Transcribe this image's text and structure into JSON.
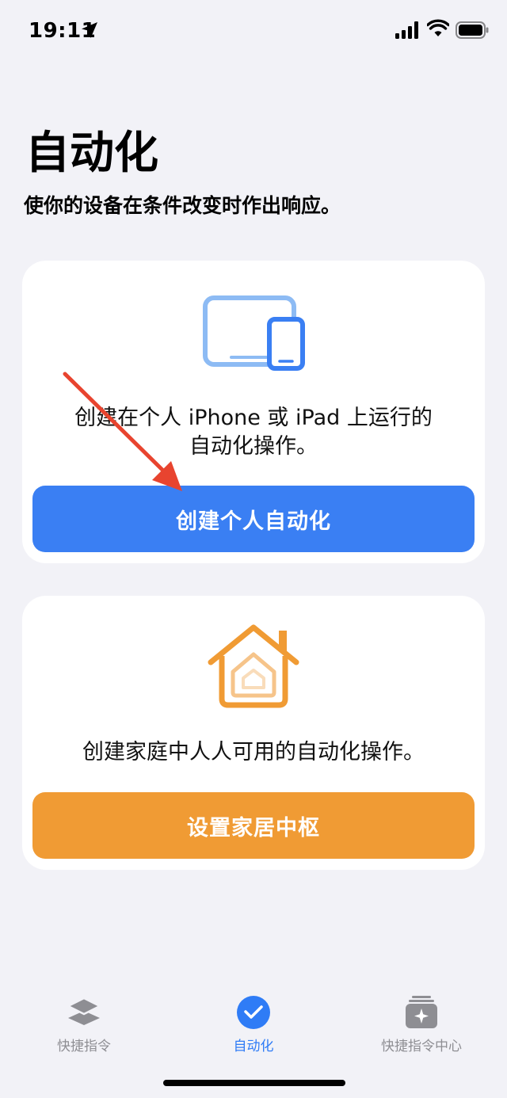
{
  "status_bar": {
    "time": "19:11",
    "icons": [
      "location-arrow-icon",
      "cellular-signal-icon",
      "wifi-icon",
      "battery-icon"
    ]
  },
  "page": {
    "title": "自动化",
    "subtitle": "使你的设备在条件改变时作出响应。"
  },
  "personal_card": {
    "icon": "ipad-iphone-icon",
    "description": "创建在个人 iPhone 或 iPad 上运行的自动化操作。",
    "button_label": "创建个人自动化"
  },
  "home_card": {
    "icon": "home-icon",
    "description": "创建家庭中人人可用的自动化操作。",
    "button_label": "设置家居中枢"
  },
  "tab_bar": {
    "tabs": [
      {
        "label": "快捷指令",
        "icon": "layers-icon",
        "active": false
      },
      {
        "label": "自动化",
        "icon": "checkmark-clock-icon",
        "active": true
      },
      {
        "label": "快捷指令中心",
        "icon": "gallery-sparkle-icon",
        "active": false
      }
    ]
  },
  "colors": {
    "background": "#f2f2f7",
    "personal_button": "#3a7ff3",
    "home_button": "#f09b34",
    "active_tab": "#2f7cf6",
    "inactive_tab": "#8e8e93",
    "annotation_arrow": "#e8442f"
  }
}
